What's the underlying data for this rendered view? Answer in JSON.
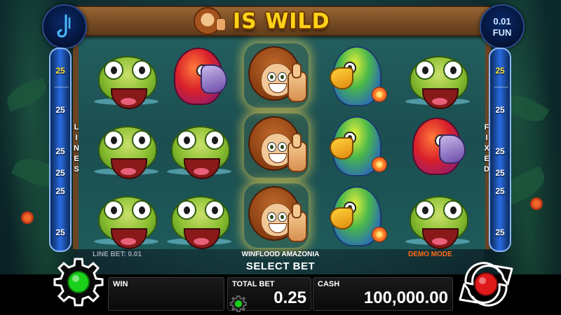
{
  "game": {
    "title": "IS WILD",
    "name": "WINFLOOD AMAZONIA",
    "mode": "DEMO MODE",
    "select_bet": "SELECT BET"
  },
  "corner_right": {
    "amount": "0.01",
    "currency": "FUN"
  },
  "side_left": {
    "label": "LINES",
    "values": [
      "25",
      "25",
      "25",
      "25",
      "25",
      "25"
    ],
    "active_index": 0
  },
  "side_right": {
    "label": "FIXED",
    "values": [
      "25",
      "25",
      "25",
      "25",
      "25",
      "25"
    ],
    "active_index": 0
  },
  "line_bet": "LINE BET: 0.01",
  "panels": {
    "win": {
      "label": "WIN",
      "value": ""
    },
    "total_bet": {
      "label": "TOTAL BET",
      "value": "0.25"
    },
    "cash": {
      "label": "CASH",
      "value": "100,000.00"
    }
  },
  "reels": [
    [
      "frog",
      "frog",
      "frog"
    ],
    [
      "parrot-red",
      "frog",
      "frog"
    ],
    [
      "monkey",
      "monkey",
      "monkey"
    ],
    [
      "parrot-green",
      "parrot-green",
      "parrot-green"
    ],
    [
      "frog",
      "parrot-red",
      "frog"
    ]
  ],
  "colors": {
    "accent_gold": "#ffd21a",
    "demo_orange": "#ff6a1a",
    "spin_red": "#e01a1a",
    "settings_green": "#1ad01a"
  }
}
